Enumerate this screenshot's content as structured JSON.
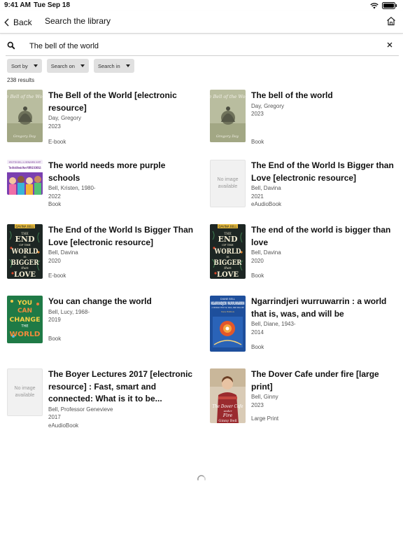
{
  "status": {
    "time": "9:41 AM",
    "date": "Tue Sep 18",
    "battery": "100%"
  },
  "nav": {
    "back_label": "Back",
    "title": "Search the library"
  },
  "search": {
    "query": "The bell of the world"
  },
  "filters": [
    {
      "label": "Sort by"
    },
    {
      "label": "Search on"
    },
    {
      "label": "Search in"
    }
  ],
  "results_count": "238 results",
  "results": [
    {
      "title": "The Bell of the World [electronic resource]",
      "author": "Day, Gregory",
      "year": "2023",
      "format": "E-book",
      "cover": "bell-of-world"
    },
    {
      "title": "The bell of the world",
      "author": "Day, Gregory",
      "year": "2023",
      "format": "Book",
      "cover": "bell-of-world"
    },
    {
      "title": "The world needs more purple schools",
      "author": "Bell, Kristen, 1980-",
      "year": "2022",
      "format": "Book",
      "cover": "purple-schools"
    },
    {
      "title": "The End of the World Is Bigger than Love [electronic resource]",
      "author": "Bell, Davina",
      "year": "2021",
      "format": "eAudioBook",
      "cover": "no-image",
      "no_image_text": "No image available"
    },
    {
      "title": "The End of the World Is Bigger Than Love [electronic resource]",
      "author": "Bell, Davina",
      "year": "2020",
      "format": "E-book",
      "cover": "end-of-world"
    },
    {
      "title": "The end of the world is bigger than love",
      "author": "Bell, Davina",
      "year": "2020",
      "format": "Book",
      "cover": "end-of-world"
    },
    {
      "title": "You can change the world",
      "author": "Bell, Lucy, 1968-",
      "year": "2019",
      "format": "Book",
      "cover": "change-world"
    },
    {
      "title": "Ngarrindjeri wurruwarrin : a world that is, was, and will be",
      "author": "Bell, Diane, 1943-",
      "year": "2014",
      "format": "Book",
      "cover": "ngarrindjeri"
    },
    {
      "title": "The Boyer Lectures 2017 [electronic resource] : Fast, smart and connected: What is it to be...",
      "author": "Bell, Professor Genevieve",
      "year": "2017",
      "format": "eAudioBook",
      "cover": "no-image",
      "no_image_text": "No image available"
    },
    {
      "title": "The Dover Cafe under fire [large print]",
      "author": "Bell, Ginny",
      "year": "2023",
      "format": "Large Print",
      "cover": "dover-cafe"
    }
  ],
  "cover_texts": {
    "bell_of_world": "The Bell of the World",
    "bell_author": "Gregory Day",
    "purple_author": "KRISTEN BELL & BENJAMIN HART",
    "purple_title": "The World Needs More PURPLE SCHOOLS",
    "end_author": "DAVINA BELL",
    "end_the": "THE",
    "end_end": "END",
    "end_of_the": "OF THE",
    "end_world": "WORLD",
    "end_is": "IS",
    "end_bigger": "BIGGER",
    "end_than": "than",
    "end_love": "LOVE",
    "change_you": "YOU",
    "change_can": "CAN",
    "change_change": "CHANGE",
    "change_the": "THE",
    "change_world": "WORLD",
    "ngar_author": "DIANE BELL",
    "ngar_title": "NGARRINDJERI WURRUWARRIN",
    "ngar_sub": "A WORLD THAT IS, WAS, AND WILL BE",
    "ngar_edition": "New Edition",
    "dover_title": "The Dover Cafe",
    "dover_under": "under",
    "dover_fire": "Fire",
    "dover_author": "Ginny Bell"
  }
}
